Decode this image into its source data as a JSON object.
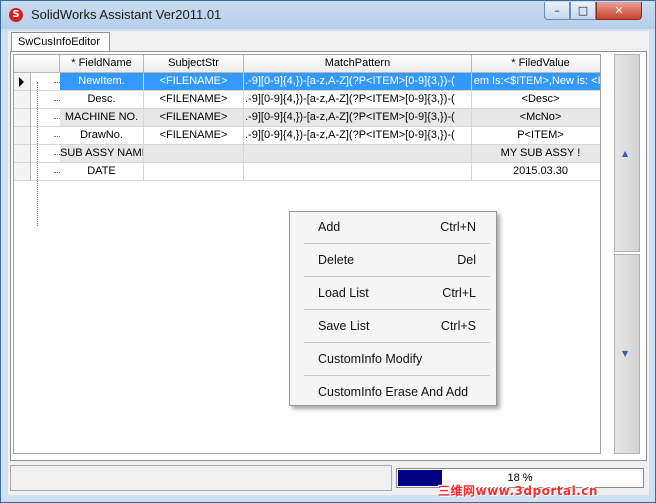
{
  "window": {
    "title": "SolidWorks Assistant Ver2011.01",
    "min_glyph": "–",
    "max_glyph": "□",
    "close_glyph": "✕"
  },
  "tab": {
    "label": "SwCusInfoEditor"
  },
  "grid": {
    "headers": {
      "field": "* FieldName",
      "subject": "SubjectStr",
      "match": "MatchPattern",
      "value": "* FiledValue"
    },
    "rows": [
      {
        "field": "NewItem.",
        "subject": "<FILENAME>",
        "match": ".-9][0-9]{4,})-[a-z,A-Z](?P<ITEM>[0-9]{3,})-(",
        "value": "em Is:<$ITEM>,New is: <IT",
        "selected": true
      },
      {
        "field": "Desc.",
        "subject": "<FILENAME>",
        "match": ".-9][0-9]{4,})-[a-z,A-Z](?P<ITEM>[0-9]{3,})-(",
        "value": "<Desc>"
      },
      {
        "field": "MACHINE NO.",
        "subject": "<FILENAME>",
        "match": ".-9][0-9]{4,})-[a-z,A-Z](?P<ITEM>[0-9]{3,})-(",
        "value": "<McNo>"
      },
      {
        "field": "DrawNo.",
        "subject": "<FILENAME>",
        "match": ".-9][0-9]{4,})-[a-z,A-Z](?P<ITEM>[0-9]{3,})-(",
        "value": "P<ITEM>"
      },
      {
        "field": "SUB ASSY NAME",
        "subject": "",
        "match": "",
        "value": "MY SUB ASSY !"
      },
      {
        "field": "DATE",
        "subject": "",
        "match": "",
        "value": "2015.03.30"
      }
    ]
  },
  "context_menu": {
    "items": [
      {
        "label": "Add",
        "shortcut": "Ctrl+N"
      },
      {
        "label": "Delete",
        "shortcut": "Del"
      },
      {
        "label": "Load List",
        "shortcut": "Ctrl+L"
      },
      {
        "label": "Save List",
        "shortcut": "Ctrl+S"
      },
      {
        "label": "CustomInfo Modify",
        "shortcut": ""
      },
      {
        "label": "CustomInfo Erase And Add",
        "shortcut": ""
      }
    ]
  },
  "sidebar": {
    "up_glyph": "▲",
    "down_glyph": "▼"
  },
  "status": {
    "progress_fraction": 0.18,
    "progress_text": "18 %"
  },
  "watermark": "三维网www.3dportal.cn"
}
